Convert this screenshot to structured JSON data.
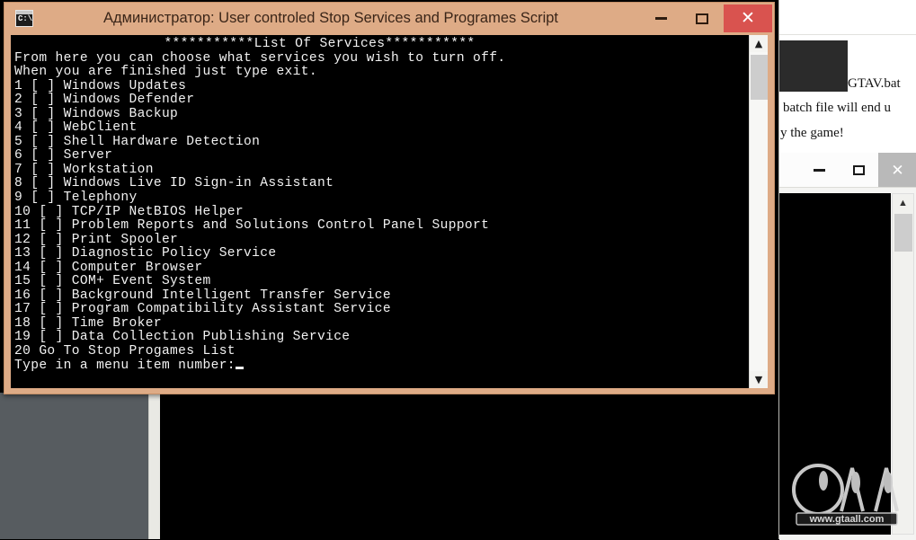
{
  "window": {
    "title": "Администратор:  User controled Stop Services and Programes Script",
    "icon_name": "cmd-console-icon",
    "icon_text": "C:\\.",
    "buttons": {
      "minimize": "–",
      "maximize": "□",
      "close": "✕"
    },
    "close_color": "#d9534f",
    "frame_color": "#deab86"
  },
  "console": {
    "header": "***********List Of Services***********",
    "intro_line_1": "From here you can choose what services you wish to turn off.",
    "intro_line_2": "When you are finished just type exit.",
    "menu": [
      {
        "num": "1",
        "box": "[ ]",
        "label": "Windows Updates"
      },
      {
        "num": "2",
        "box": "[ ]",
        "label": "Windows Defender"
      },
      {
        "num": "3",
        "box": "[ ]",
        "label": "Windows Backup"
      },
      {
        "num": "4",
        "box": "[ ]",
        "label": "WebClient"
      },
      {
        "num": "5",
        "box": "[ ]",
        "label": "Shell Hardware Detection"
      },
      {
        "num": "6",
        "box": "[ ]",
        "label": "Server"
      },
      {
        "num": "7",
        "box": "[ ]",
        "label": "Workstation"
      },
      {
        "num": "8",
        "box": "[ ]",
        "label": "Windows Live ID Sign-in Assistant"
      },
      {
        "num": "9",
        "box": "[ ]",
        "label": "Telephony"
      },
      {
        "num": "10",
        "box": "[ ]",
        "label": "TCP/IP NetBIOS Helper"
      },
      {
        "num": "11",
        "box": "[ ]",
        "label": "Problem Reports and Solutions Control Panel Support"
      },
      {
        "num": "12",
        "box": "[ ]",
        "label": "Print Spooler"
      },
      {
        "num": "13",
        "box": "[ ]",
        "label": "Diagnostic Policy Service"
      },
      {
        "num": "14",
        "box": "[ ]",
        "label": "Computer Browser"
      },
      {
        "num": "15",
        "box": "[ ]",
        "label": "COM+ Event System"
      },
      {
        "num": "16",
        "box": "[ ]",
        "label": "Background Intelligent Transfer Service"
      },
      {
        "num": "17",
        "box": "[ ]",
        "label": "Program Compatibility Assistant Service"
      },
      {
        "num": "18",
        "box": "[ ]",
        "label": "Time Broker"
      },
      {
        "num": "19",
        "box": "[ ]",
        "label": "Data Collection Publishing Service"
      },
      {
        "num": "20",
        "box": "",
        "label": "Go To Stop Progames List"
      }
    ],
    "prompt": "Type in a menu item number:",
    "text_color": "#f2f2f2",
    "background_color": "#000000"
  },
  "background_doc_window": {
    "line_1": "GTAV.bat",
    "line_2": "batch file will end u",
    "line_3": "y the game!"
  },
  "background_console_window": {
    "buttons": {
      "minimize": "–",
      "maximize": "□",
      "close": "✕"
    }
  },
  "watermark": {
    "logo_text": "GTA",
    "url_text": "www.gtaall.com"
  }
}
